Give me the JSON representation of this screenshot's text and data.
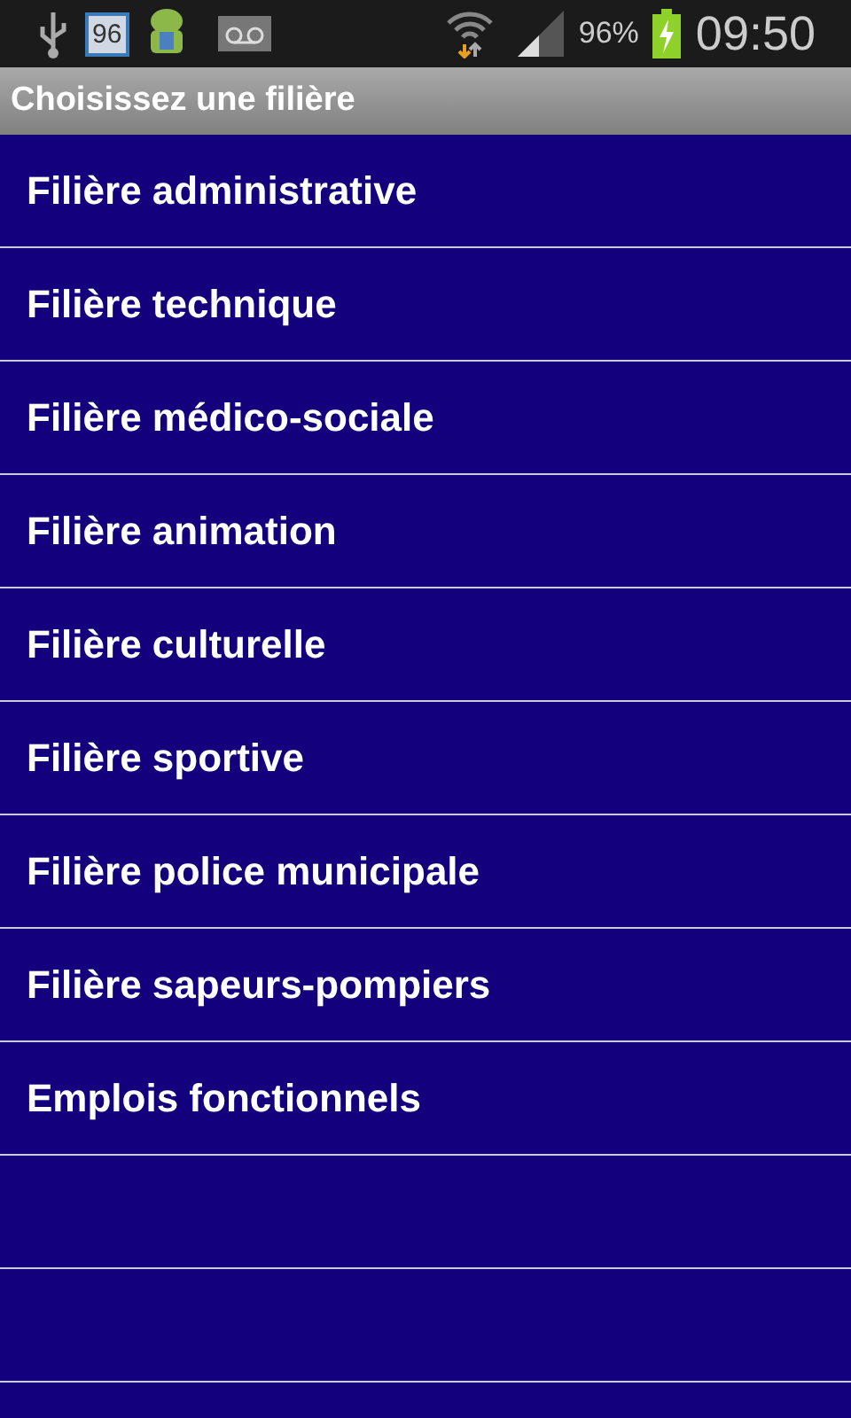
{
  "status_bar": {
    "notification_badge": "96",
    "battery_percent": "96%",
    "time": "09:50"
  },
  "title_bar": {
    "title": "Choisissez une filière"
  },
  "list": {
    "items": [
      {
        "label": "Filière administrative"
      },
      {
        "label": "Filière technique"
      },
      {
        "label": "Filière médico-sociale"
      },
      {
        "label": "Filière animation"
      },
      {
        "label": "Filière culturelle"
      },
      {
        "label": "Filière sportive"
      },
      {
        "label": "Filière police municipale"
      },
      {
        "label": "Filière sapeurs-pompiers"
      },
      {
        "label": "Emplois fonctionnels"
      }
    ]
  }
}
